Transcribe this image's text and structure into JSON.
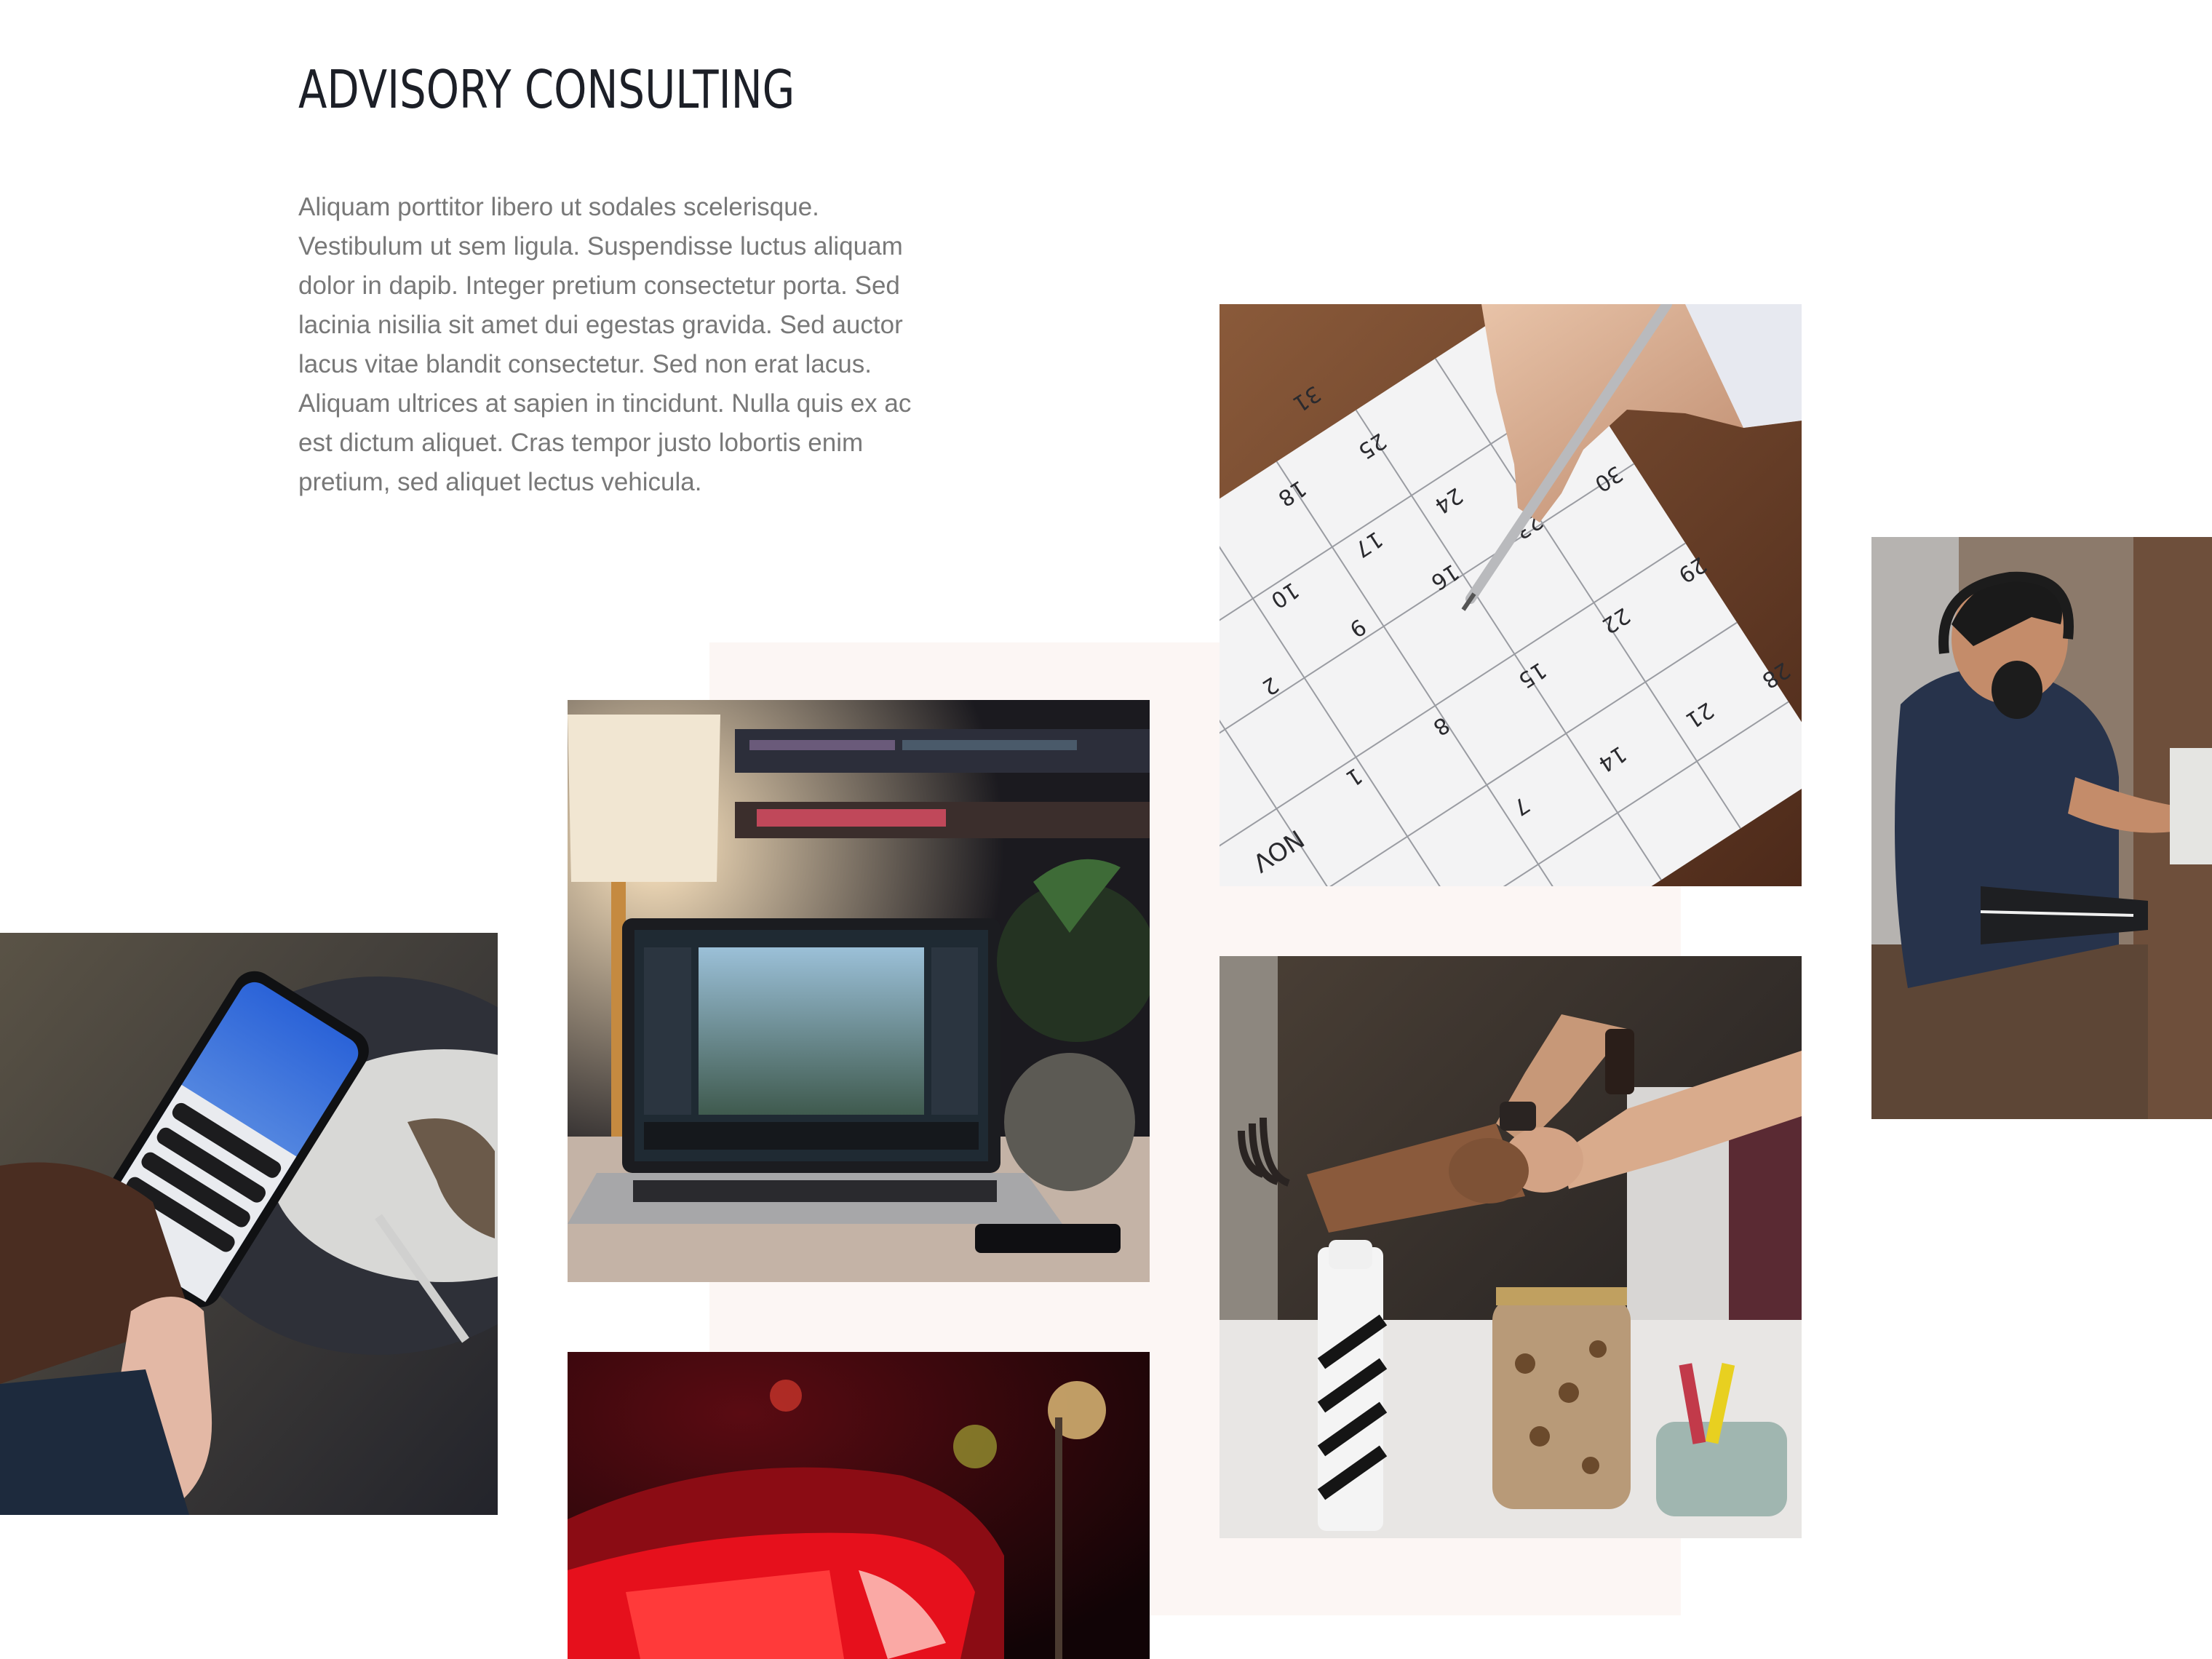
{
  "section": {
    "title": "ADVISORY CONSULTING",
    "body": "Aliquam porttitor libero ut sodales scelerisque. Vestibulum ut sem ligula. Suspendisse luctus aliquam dolor in dapib. Integer pretium consectetur porta. Sed lacinia nisilia sit amet dui egestas gravida. Sed auctor lacus vitae blandit consectetur. Sed non erat lacus. Aliquam ultrices at sapien in tincidunt. Nulla quis ex ac est dictum aliquet. Cras tempor justo lobortis enim pretium, sed aliquet lectus vehicula."
  },
  "calendar": {
    "month": "NOV",
    "rows": [
      [
        "1",
        "8",
        "15",
        "22",
        "29"
      ],
      [
        "2",
        "9",
        "16",
        "23",
        "30"
      ],
      [
        "7",
        "14",
        "21",
        "28"
      ],
      [
        "10",
        "17",
        "24"
      ],
      [
        "18",
        "25"
      ],
      [
        "31"
      ]
    ]
  },
  "colors": {
    "title": "#1c1f27",
    "body_text": "#787878",
    "panel_background": "#fcf6f4"
  }
}
